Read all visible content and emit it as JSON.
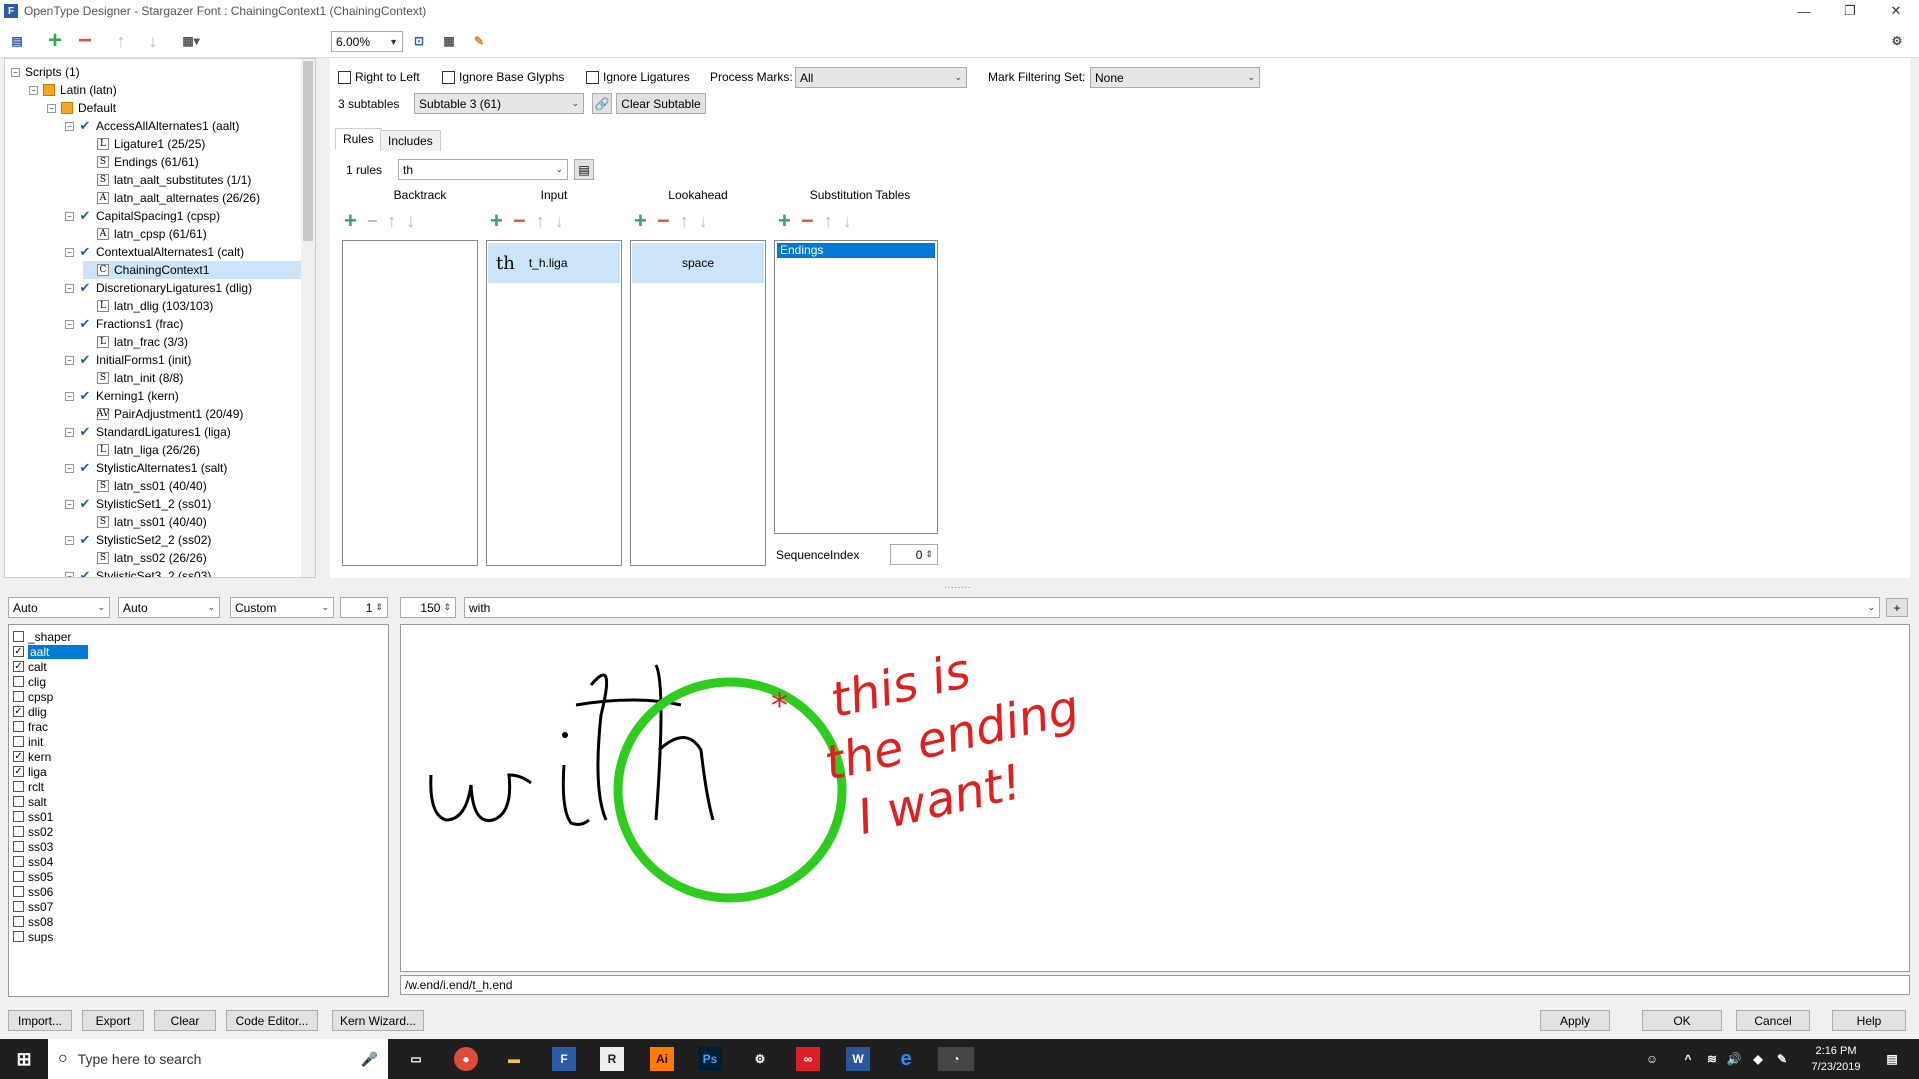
{
  "window": {
    "title": "OpenType Designer - Stargazer Font : ChainingContext1 (ChainingContext)",
    "app_icon": "opentype-designer-icon"
  },
  "toolbar": {
    "zoom": "6.00%"
  },
  "tree": {
    "nodes": [
      {
        "label": "Scripts (1)",
        "icon": "none",
        "level": 0
      },
      {
        "label": "Latin (latn)",
        "icon": "folder",
        "level": 1
      },
      {
        "label": "Default",
        "icon": "folder",
        "level": 2
      },
      {
        "label": "AccessAllAlternates1 (aalt)",
        "icon": "check",
        "level": 3
      },
      {
        "label": "Ligature1 (25/25)",
        "icon": "L",
        "level": 4
      },
      {
        "label": "Endings (61/61)",
        "icon": "S",
        "level": 4
      },
      {
        "label": "latn_aalt_substitutes (1/1)",
        "icon": "S",
        "level": 4
      },
      {
        "label": "latn_aalt_alternates (26/26)",
        "icon": "A",
        "level": 4
      },
      {
        "label": "CapitalSpacing1 (cpsp)",
        "icon": "check",
        "level": 3
      },
      {
        "label": "latn_cpsp (61/61)",
        "icon": "A",
        "level": 4
      },
      {
        "label": "ContextualAlternates1 (calt)",
        "icon": "check",
        "level": 3
      },
      {
        "label": "ChainingContext1",
        "icon": "C",
        "level": 4,
        "selected": true
      },
      {
        "label": "DiscretionaryLigatures1 (dlig)",
        "icon": "check",
        "level": 3
      },
      {
        "label": "latn_dlig (103/103)",
        "icon": "L",
        "level": 4
      },
      {
        "label": "Fractions1 (frac)",
        "icon": "check",
        "level": 3
      },
      {
        "label": "latn_frac (3/3)",
        "icon": "L",
        "level": 4
      },
      {
        "label": "InitialForms1 (init)",
        "icon": "check",
        "level": 3
      },
      {
        "label": "latn_init (8/8)",
        "icon": "S",
        "level": 4
      },
      {
        "label": "Kerning1 (kern)",
        "icon": "check",
        "level": 3
      },
      {
        "label": "PairAdjustment1 (20/49)",
        "icon": "AV",
        "level": 4
      },
      {
        "label": "StandardLigatures1 (liga)",
        "icon": "check",
        "level": 3
      },
      {
        "label": "latn_liga (26/26)",
        "icon": "L",
        "level": 4
      },
      {
        "label": "StylisticAlternates1 (salt)",
        "icon": "check",
        "level": 3
      },
      {
        "label": "latn_ss01 (40/40)",
        "icon": "S",
        "level": 4
      },
      {
        "label": "StylisticSet1_2 (ss01)",
        "icon": "check",
        "level": 3
      },
      {
        "label": "latn_ss01 (40/40)",
        "icon": "S",
        "level": 4
      },
      {
        "label": "StylisticSet2_2 (ss02)",
        "icon": "check",
        "level": 3
      },
      {
        "label": "latn_ss02 (26/26)",
        "icon": "S",
        "level": 4
      },
      {
        "label": "StylisticSet3_2 (ss03)",
        "icon": "check",
        "level": 3
      }
    ]
  },
  "options": {
    "right_to_left": "Right to Left",
    "ignore_base": "Ignore Base Glyphs",
    "ignore_lig": "Ignore Ligatures",
    "process_marks_label": "Process Marks:",
    "process_marks_value": "All",
    "mark_filter_label": "Mark Filtering Set:",
    "mark_filter_value": "None",
    "subtables_count": "3 subtables",
    "subtable_value": "Subtable 3 (61)",
    "clear_subtable": "Clear Subtable"
  },
  "tabs": {
    "rules": "Rules",
    "includes": "Includes"
  },
  "rules": {
    "count": "1 rules",
    "selected": "th",
    "columns": {
      "backtrack": "Backtrack",
      "input": "Input",
      "lookahead": "Lookahead",
      "subst": "Substitution Tables"
    },
    "input_glyph": "th",
    "input_name": "t_h.liga",
    "lookahead_name": "space",
    "subst_item": "Endings",
    "seq_label": "SequenceIndex",
    "seq_value": "0"
  },
  "preview_controls": {
    "dd1": "Auto",
    "dd2": "Auto",
    "dd3": "Custom",
    "spin1": "1",
    "spin2": "150",
    "text": "with",
    "plus": "+"
  },
  "features": [
    {
      "tag": "_shaper",
      "checked": false
    },
    {
      "tag": "aalt",
      "checked": true,
      "selected": true
    },
    {
      "tag": "calt",
      "checked": true
    },
    {
      "tag": "clig",
      "checked": false
    },
    {
      "tag": "cpsp",
      "checked": false
    },
    {
      "tag": "dlig",
      "checked": true
    },
    {
      "tag": "frac",
      "checked": false
    },
    {
      "tag": "init",
      "checked": false
    },
    {
      "tag": "kern",
      "checked": true
    },
    {
      "tag": "liga",
      "checked": true
    },
    {
      "tag": "rclt",
      "checked": false
    },
    {
      "tag": "salt",
      "checked": false
    },
    {
      "tag": "ss01",
      "checked": false
    },
    {
      "tag": "ss02",
      "checked": false
    },
    {
      "tag": "ss03",
      "checked": false
    },
    {
      "tag": "ss04",
      "checked": false
    },
    {
      "tag": "ss05",
      "checked": false
    },
    {
      "tag": "ss06",
      "checked": false
    },
    {
      "tag": "ss07",
      "checked": false
    },
    {
      "tag": "ss08",
      "checked": false
    },
    {
      "tag": "sups",
      "checked": false
    }
  ],
  "preview": {
    "sample": "with",
    "annotation_lines": [
      "this is",
      "the ending",
      "I want!"
    ],
    "annotation_star": "*",
    "colors": {
      "circle": "#2ecc1f",
      "annotation": "#e02020"
    }
  },
  "glyph_string": "/w.end/i.end/t_h.end",
  "bottom_buttons": {
    "import": "Import...",
    "export": "Export",
    "clear": "Clear",
    "code": "Code Editor...",
    "kern": "Kern Wizard...",
    "apply": "Apply",
    "ok": "OK",
    "cancel": "Cancel",
    "help": "Help"
  },
  "taskbar": {
    "search": "Type here to search",
    "time": "2:16 PM",
    "date": "7/23/2019"
  }
}
